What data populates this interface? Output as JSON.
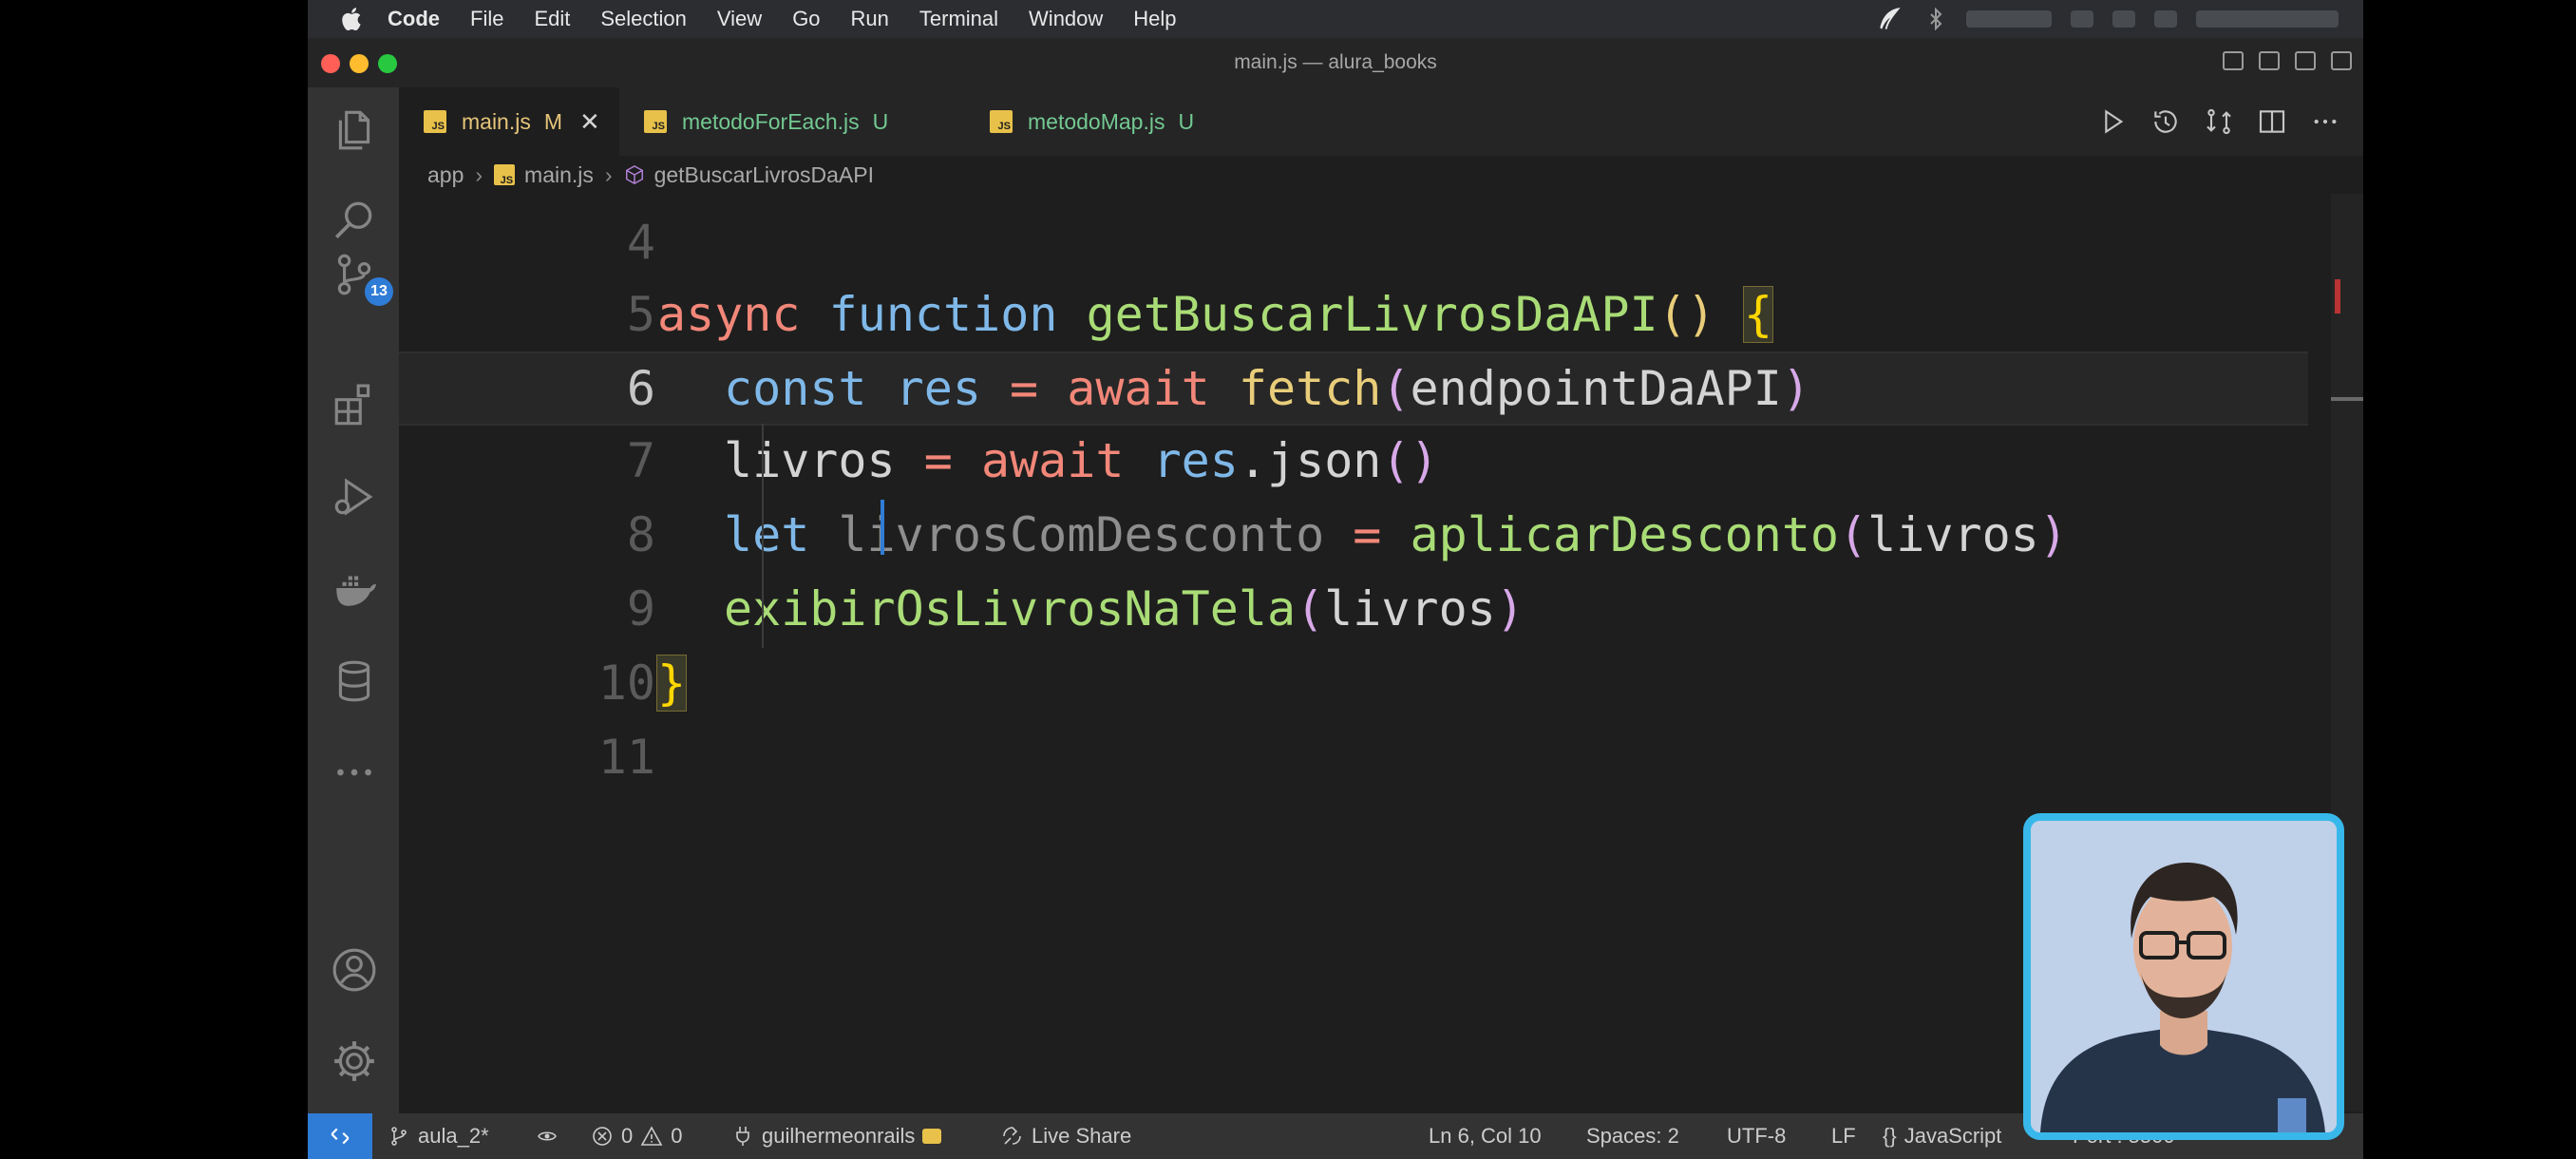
{
  "menubar": {
    "app": "Code",
    "items": [
      "File",
      "Edit",
      "Selection",
      "View",
      "Go",
      "Run",
      "Terminal",
      "Window",
      "Help"
    ]
  },
  "window": {
    "title": "main.js — alura_books"
  },
  "activity": {
    "scm_badge": "13"
  },
  "tabs": [
    {
      "name": "main.js",
      "status": "M",
      "active": true,
      "close": "✕"
    },
    {
      "name": "metodoForEach.js",
      "status": "U",
      "active": false
    },
    {
      "name": "metodoMap.js",
      "status": "U",
      "active": false
    }
  ],
  "breadcrumb": {
    "folder": "app",
    "file": "main.js",
    "symbol": "getBuscarLivrosDaAPI"
  },
  "editor": {
    "current_line": 6,
    "lines": [
      {
        "n": "4"
      },
      {
        "n": "5",
        "t": {
          "a": "async",
          "b": "function",
          "c": "getBuscarLivrosDaAPI",
          "d": "()",
          "e": "{"
        }
      },
      {
        "n": "6",
        "t": {
          "a": "const",
          "b": "res",
          "c": "=",
          "d": "await",
          "e": "fetch",
          "f": "(",
          "g": "endpointDaAPI",
          "h": ")"
        }
      },
      {
        "n": "7",
        "t": {
          "a": "livros",
          "b": "=",
          "c": "await",
          "d": "res",
          "e": ".json",
          "f": "()"
        }
      },
      {
        "n": "8",
        "t": {
          "a": "let",
          "b": "livrosComDesconto",
          "c": "=",
          "d": "aplicarDesconto",
          "e": "(",
          "f": "livros",
          "g": ")"
        }
      },
      {
        "n": "9",
        "t": {
          "a": "exibirOsLivrosNaTela",
          "b": "(",
          "c": "livros",
          "d": ")"
        }
      },
      {
        "n": "10",
        "t": {
          "a": "}"
        }
      },
      {
        "n": "11"
      }
    ]
  },
  "statusbar": {
    "branch": "aula_2*",
    "errors": "0",
    "warnings": "0",
    "account": "guilhermeonrails",
    "live_share": "Live Share",
    "position": "Ln 6, Col 10",
    "spaces": "Spaces: 2",
    "encoding": "UTF-8",
    "eol": "LF",
    "language_braces": "{}",
    "language": "JavaScript",
    "port": "Port : 5500"
  },
  "colors": {
    "accent": "#2f7cd6",
    "modified": "#e6c47a",
    "untracked": "#73c991",
    "keyword": "#f28779",
    "function": "#e9cd7a",
    "webcam_border": "#38b8ea"
  },
  "icons": {
    "activity": [
      "explorer-icon",
      "search-icon",
      "source-control-icon",
      "extensions-icon",
      "run-debug-icon",
      "docker-icon",
      "database-icon",
      "more-icon",
      "account-icon",
      "settings-gear-icon"
    ],
    "editor_actions": [
      "run-icon",
      "timeline-icon",
      "compare-icon",
      "split-editor-icon",
      "more-actions-icon"
    ]
  }
}
